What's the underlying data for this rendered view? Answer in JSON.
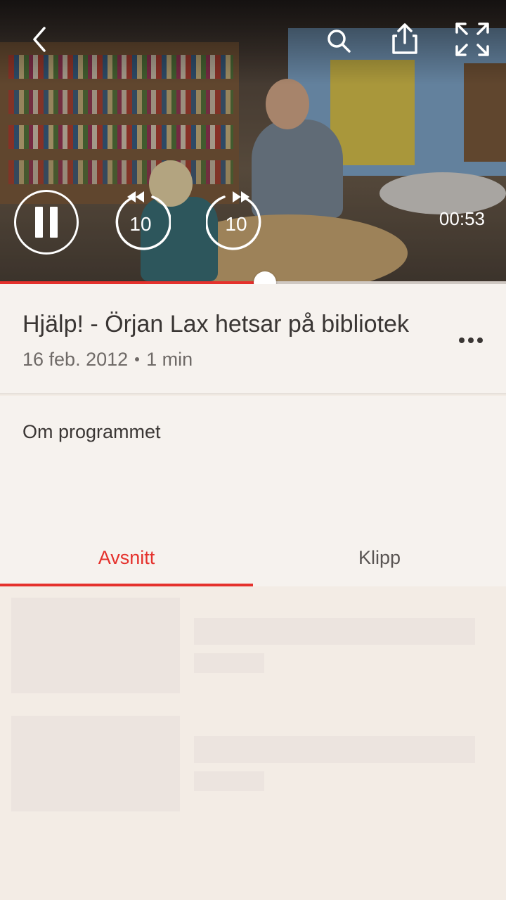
{
  "player": {
    "elapsed_time": "00:53",
    "progress_fraction": 0.523,
    "rewind_seconds": "10",
    "forward_seconds": "10",
    "icons": [
      "back-icon",
      "search-icon",
      "share-icon",
      "fullscreen-icon",
      "pause-icon",
      "rewind-10-icon",
      "forward-10-icon"
    ]
  },
  "program": {
    "title": "Hjälp! - Örjan Lax hetsar på bibliotek",
    "date": "16 feb. 2012",
    "duration": "1 min",
    "more_icon": "more-options-icon"
  },
  "about": {
    "label": "Om programmet"
  },
  "tabs": [
    {
      "label": "Avsnitt",
      "active": true
    },
    {
      "label": "Klipp",
      "active": false
    }
  ],
  "colors": {
    "accent": "#e5312c",
    "background": "#f3ece5",
    "card": "#f6f2ee",
    "skeleton": "#ece4df"
  }
}
